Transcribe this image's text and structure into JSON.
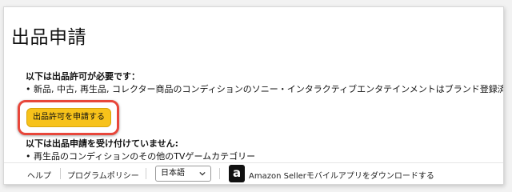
{
  "page": {
    "title": "出品申請"
  },
  "approval_required": {
    "heading": "以下は出品許可が必要です：",
    "items": [
      "• 新品, 中古, 再生品, コレクター商品のコンディションのソニー・インタラクティブエンタテインメントはブランド登録済み"
    ]
  },
  "actions": {
    "apply_label": "出品許可を申請する"
  },
  "not_accepting": {
    "heading": "以下は出品申請を受け付けていません:",
    "items": [
      "• 再生品のコンディションのその他のTVゲームカテゴリー"
    ]
  },
  "footer": {
    "help_label": "ヘルプ",
    "policy_label": "プログラムポリシー",
    "language_selected": "日本語",
    "app_icon_glyph": "a",
    "app_download_label": "Amazon Sellerモバイルアプリをダウンロードする"
  },
  "colors": {
    "button_bg": "#f7c21a",
    "highlight_border": "#e8473b"
  }
}
